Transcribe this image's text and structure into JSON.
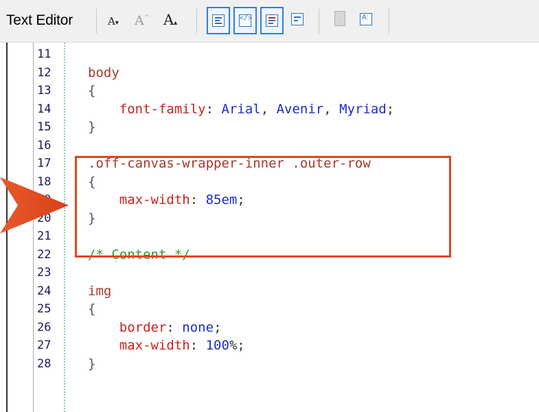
{
  "toolbar": {
    "title": "Text Editor",
    "decrease_font_label": "A",
    "default_font_label": "A",
    "increase_font_label": "A"
  },
  "lines": [
    {
      "num": "11",
      "tokens": []
    },
    {
      "num": "12",
      "tokens": [
        {
          "t": "body",
          "c": "sel"
        }
      ]
    },
    {
      "num": "13",
      "tokens": [
        {
          "t": "{",
          "c": "brace"
        }
      ]
    },
    {
      "num": "14",
      "tokens": [
        {
          "t": "    ",
          "c": "punc"
        },
        {
          "t": "font-family",
          "c": "prop"
        },
        {
          "t": ": ",
          "c": "punc"
        },
        {
          "t": "Arial",
          "c": "val"
        },
        {
          "t": ", ",
          "c": "punc"
        },
        {
          "t": "Avenir",
          "c": "val"
        },
        {
          "t": ", ",
          "c": "punc"
        },
        {
          "t": "Myriad",
          "c": "val"
        },
        {
          "t": ";",
          "c": "punc"
        }
      ]
    },
    {
      "num": "15",
      "tokens": [
        {
          "t": "}",
          "c": "brace"
        }
      ]
    },
    {
      "num": "16",
      "tokens": []
    },
    {
      "num": "17",
      "tokens": [
        {
          "t": ".off-canvas-wrapper-inner .outer-row",
          "c": "sel"
        }
      ]
    },
    {
      "num": "18",
      "tokens": [
        {
          "t": "{",
          "c": "brace"
        }
      ]
    },
    {
      "num": "19",
      "tokens": [
        {
          "t": "    ",
          "c": "punc"
        },
        {
          "t": "max-width",
          "c": "prop"
        },
        {
          "t": ": ",
          "c": "punc"
        },
        {
          "t": "85em",
          "c": "val"
        },
        {
          "t": ";",
          "c": "punc"
        }
      ]
    },
    {
      "num": "20",
      "tokens": [
        {
          "t": "}",
          "c": "brace"
        }
      ]
    },
    {
      "num": "21",
      "tokens": []
    },
    {
      "num": "22",
      "tokens": [
        {
          "t": "/* Content */",
          "c": "comment"
        }
      ]
    },
    {
      "num": "23",
      "tokens": []
    },
    {
      "num": "24",
      "tokens": [
        {
          "t": "img",
          "c": "sel"
        }
      ]
    },
    {
      "num": "25",
      "tokens": [
        {
          "t": "{",
          "c": "brace"
        }
      ]
    },
    {
      "num": "26",
      "tokens": [
        {
          "t": "    ",
          "c": "punc"
        },
        {
          "t": "border",
          "c": "prop"
        },
        {
          "t": ": ",
          "c": "punc"
        },
        {
          "t": "none",
          "c": "val"
        },
        {
          "t": ";",
          "c": "punc"
        }
      ]
    },
    {
      "num": "27",
      "tokens": [
        {
          "t": "    ",
          "c": "punc"
        },
        {
          "t": "max-width",
          "c": "prop"
        },
        {
          "t": ": ",
          "c": "punc"
        },
        {
          "t": "100",
          "c": "val"
        },
        {
          "t": "%;",
          "c": "punc"
        }
      ]
    },
    {
      "num": "28",
      "tokens": [
        {
          "t": "}",
          "c": "brace"
        }
      ]
    }
  ],
  "highlight_color": "#e0461e"
}
